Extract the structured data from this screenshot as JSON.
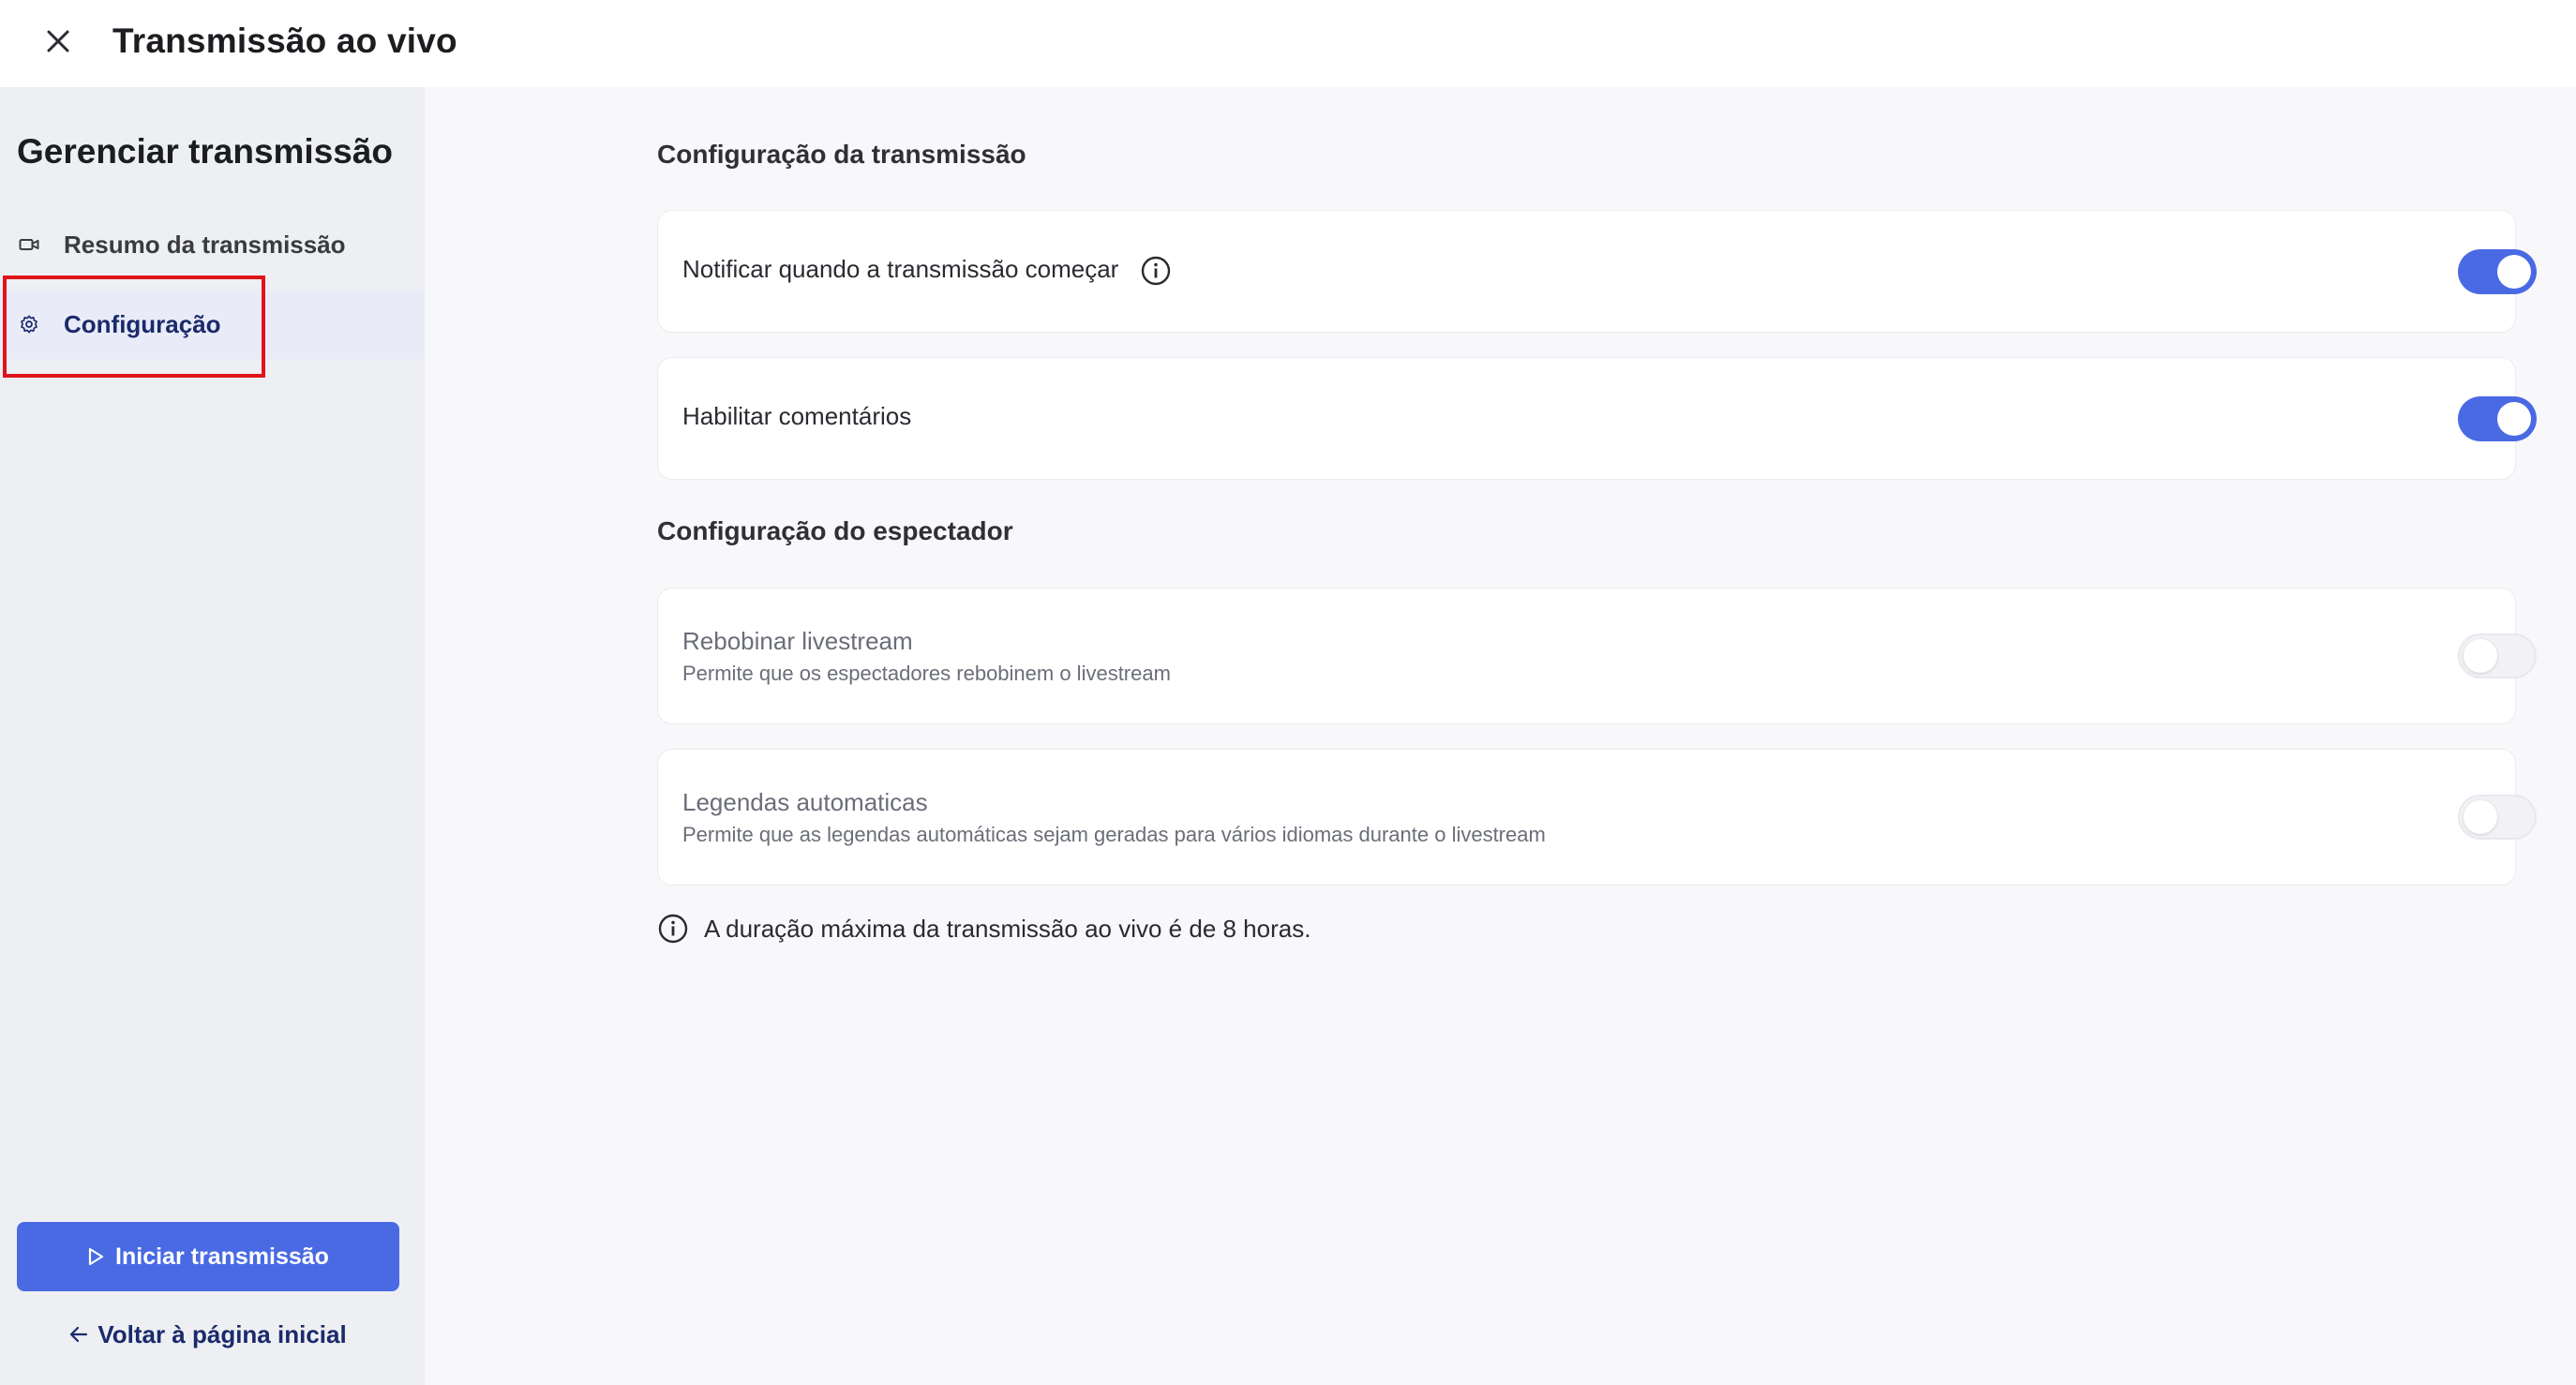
{
  "window": {
    "title": "Transmissão ao vivo"
  },
  "sidebar": {
    "title": "Gerenciar transmissão",
    "items": [
      {
        "label": "Resumo da transmissão",
        "icon": "video-camera-icon"
      },
      {
        "label": "Configuração",
        "icon": "gear-icon",
        "selected": true
      }
    ],
    "start_button": "Iniciar transmissão",
    "back_link": "Voltar à página inicial"
  },
  "main": {
    "section1": {
      "title": "Configuração da transmissão",
      "rows": [
        {
          "label": "Notificar quando a transmissão começar",
          "enabled": true,
          "has_info": true
        },
        {
          "label": "Habilitar comentários",
          "enabled": true
        }
      ]
    },
    "section2": {
      "title": "Configuração do espectador",
      "rows": [
        {
          "label": "Rebobinar livestream",
          "description": "Permite que os espectadores rebobinem o livestream",
          "enabled": false
        },
        {
          "label": "Legendas automaticas",
          "description": "Permite que as legendas automáticas sejam geradas para vários idiomas durante o livestream",
          "enabled": false
        }
      ]
    },
    "note": "A duração máxima da transmissão ao vivo é de 8 horas."
  },
  "colors": {
    "accent": "#4a6ae4",
    "nav_selected_text": "#1a2a6b",
    "highlight_box": "#e0141b"
  }
}
